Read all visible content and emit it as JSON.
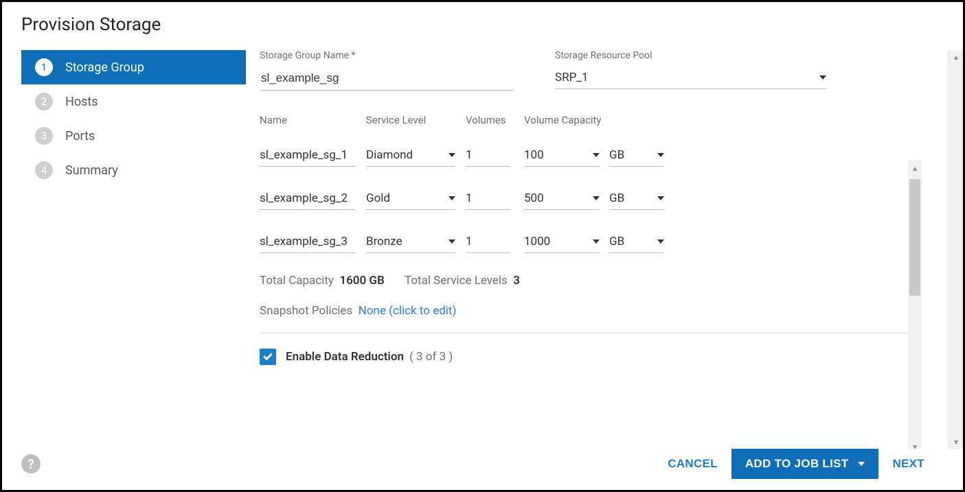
{
  "title": "Provision Storage",
  "steps": [
    {
      "num": "1",
      "label": "Storage Group",
      "active": true
    },
    {
      "num": "2",
      "label": "Hosts",
      "active": false
    },
    {
      "num": "3",
      "label": "Ports",
      "active": false
    },
    {
      "num": "4",
      "label": "Summary",
      "active": false
    }
  ],
  "fields": {
    "sg_name_label": "Storage Group Name *",
    "sg_name_value": "sl_example_sg",
    "srp_label": "Storage Resource Pool",
    "srp_value": "SRP_1"
  },
  "columns": {
    "name": "Name",
    "service": "Service Level",
    "volumes": "Volumes",
    "capacity": "Volume Capacity"
  },
  "rows": [
    {
      "name": "sl_example_sg_1",
      "service": "Diamond",
      "volumes": "1",
      "capacity": "100",
      "unit": "GB"
    },
    {
      "name": "sl_example_sg_2",
      "service": "Gold",
      "volumes": "1",
      "capacity": "500",
      "unit": "GB"
    },
    {
      "name": "sl_example_sg_3",
      "service": "Bronze",
      "volumes": "1",
      "capacity": "1000",
      "unit": "GB"
    }
  ],
  "totals": {
    "capacity_label": "Total Capacity",
    "capacity_value": "1600 GB",
    "levels_label": "Total Service Levels",
    "levels_value": "3"
  },
  "snapshot": {
    "label": "Snapshot Policies",
    "link": "None (click to edit)"
  },
  "data_reduction": {
    "label": "Enable Data Reduction",
    "count": "( 3 of 3 )",
    "checked": true
  },
  "footer": {
    "cancel": "CANCEL",
    "add": "ADD TO JOB LIST",
    "next": "NEXT"
  }
}
